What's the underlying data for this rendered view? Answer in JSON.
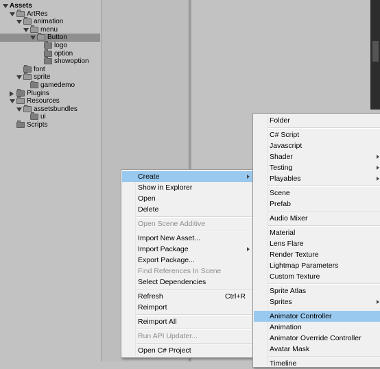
{
  "tree": [
    {
      "label": "Assets",
      "level": 0,
      "expanded": true,
      "bold": true
    },
    {
      "label": "ArtRes",
      "level": 1,
      "expanded": true
    },
    {
      "label": "animation",
      "level": 2,
      "expanded": true
    },
    {
      "label": "menu",
      "level": 3,
      "expanded": true
    },
    {
      "label": "Button",
      "level": 4,
      "expanded": true,
      "selected": true
    },
    {
      "label": "logo",
      "level": 5
    },
    {
      "label": "option",
      "level": 5
    },
    {
      "label": "showoption",
      "level": 5
    },
    {
      "label": "font",
      "level": 2
    },
    {
      "label": "sprite",
      "level": 2,
      "expanded": true
    },
    {
      "label": "gamedemo",
      "level": 3
    },
    {
      "label": "Plugins",
      "level": 1,
      "expanded": false
    },
    {
      "label": "Resources",
      "level": 1,
      "expanded": true
    },
    {
      "label": "assetsbundles",
      "level": 2,
      "expanded": true
    },
    {
      "label": "ui",
      "level": 3
    },
    {
      "label": "Scripts",
      "level": 1
    }
  ],
  "create_menu": {
    "items": [
      {
        "label": "Create",
        "highlighted": true,
        "submenu": true
      },
      {
        "label": "Show in Explorer"
      },
      {
        "label": "Open"
      },
      {
        "label": "Delete"
      },
      {
        "separator": true
      },
      {
        "label": "Open Scene Additive",
        "disabled": true
      },
      {
        "separator": true
      },
      {
        "label": "Import New Asset..."
      },
      {
        "label": "Import Package",
        "submenu": true
      },
      {
        "label": "Export Package..."
      },
      {
        "label": "Find References In Scene",
        "disabled": true
      },
      {
        "label": "Select Dependencies"
      },
      {
        "separator": true
      },
      {
        "label": "Refresh",
        "shortcut": "Ctrl+R"
      },
      {
        "label": "Reimport"
      },
      {
        "separator": true
      },
      {
        "label": "Reimport All"
      },
      {
        "separator": true
      },
      {
        "label": "Run API Updater...",
        "disabled": true
      },
      {
        "separator": true
      },
      {
        "label": "Open C# Project"
      }
    ]
  },
  "create_submenu": {
    "items": [
      {
        "label": "Folder"
      },
      {
        "separator": true
      },
      {
        "label": "C# Script"
      },
      {
        "label": "Javascript"
      },
      {
        "label": "Shader",
        "submenu": true
      },
      {
        "label": "Testing",
        "submenu": true
      },
      {
        "label": "Playables",
        "submenu": true
      },
      {
        "separator": true
      },
      {
        "label": "Scene"
      },
      {
        "label": "Prefab"
      },
      {
        "separator": true
      },
      {
        "label": "Audio Mixer"
      },
      {
        "separator": true
      },
      {
        "label": "Material"
      },
      {
        "label": "Lens Flare"
      },
      {
        "label": "Render Texture"
      },
      {
        "label": "Lightmap Parameters"
      },
      {
        "label": "Custom Texture"
      },
      {
        "separator": true
      },
      {
        "label": "Sprite Atlas"
      },
      {
        "label": "Sprites",
        "submenu": true
      },
      {
        "separator": true
      },
      {
        "label": "Animator Controller",
        "highlighted": true
      },
      {
        "label": "Animation"
      },
      {
        "label": "Animator Override Controller"
      },
      {
        "label": "Avatar Mask"
      },
      {
        "separator": true
      },
      {
        "label": "Timeline"
      }
    ]
  }
}
